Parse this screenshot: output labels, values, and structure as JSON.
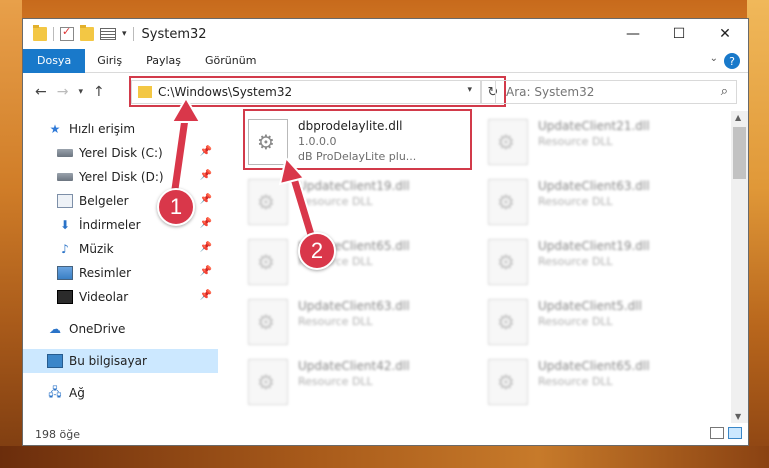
{
  "window": {
    "title": "System32"
  },
  "titlebar": {
    "quick_access_dropdown": "▾",
    "controls": {
      "minimize": "—",
      "maximize": "☐",
      "close": "✕"
    }
  },
  "ribbon": {
    "tabs": [
      {
        "label": "Dosya",
        "active": true
      },
      {
        "label": "Giriş"
      },
      {
        "label": "Paylaş"
      },
      {
        "label": "Görünüm"
      }
    ],
    "collapse_icon": "⌄",
    "help_icon": "?"
  },
  "nav": {
    "back": "←",
    "forward": "→",
    "recent": "▾",
    "up": "↑"
  },
  "address": {
    "path": "C:\\Windows\\System32",
    "dropdown": "▾",
    "refresh": "↻"
  },
  "search": {
    "placeholder": "Ara: System32",
    "icon": "⌕"
  },
  "sidebar": {
    "items": [
      {
        "label": "Hızlı erişim",
        "icon": "star-icon",
        "pinned": false
      },
      {
        "label": "Yerel Disk (C:)",
        "icon": "drive-icon",
        "pinned": true
      },
      {
        "label": "Yerel Disk (D:)",
        "icon": "drive-icon",
        "pinned": true
      },
      {
        "label": "Belgeler",
        "icon": "documents-icon",
        "pinned": true
      },
      {
        "label": "İndirmeler",
        "icon": "download-icon",
        "pinned": true
      },
      {
        "label": "Müzik",
        "icon": "music-icon",
        "pinned": true
      },
      {
        "label": "Resimler",
        "icon": "pictures-icon",
        "pinned": true
      },
      {
        "label": "Videolar",
        "icon": "videos-icon",
        "pinned": true
      },
      {
        "label": "OneDrive",
        "icon": "cloud-icon",
        "pinned": false
      },
      {
        "label": "Bu bilgisayar",
        "icon": "computer-icon",
        "pinned": false,
        "selected": true
      },
      {
        "label": "Ağ",
        "icon": "network-icon",
        "pinned": false
      }
    ],
    "pin_glyph": "📌"
  },
  "files": [
    {
      "name": "dbprodelaylite.dll",
      "version": "1.0.0.0",
      "desc": "dB ProDelayLite plu...",
      "highlighted": true
    },
    {
      "name": "UpdateClient21.dll",
      "desc": "Resource DLL"
    },
    {
      "name": "UpdateClient19.dll",
      "desc": "Resource DLL"
    },
    {
      "name": "UpdateClient63.dll",
      "desc": "Resource DLL"
    },
    {
      "name": "UpdateClient65.dll",
      "desc": "Resource DLL"
    },
    {
      "name": "UpdateClient19.dll",
      "desc": "Resource DLL"
    },
    {
      "name": "UpdateClient63.dll",
      "desc": "Resource DLL"
    },
    {
      "name": "UpdateClient5.dll",
      "desc": "Resource DLL"
    },
    {
      "name": "UpdateClient42.dll",
      "desc": "Resource DLL"
    },
    {
      "name": "UpdateClient65.dll",
      "desc": "Resource DLL"
    }
  ],
  "status": {
    "item_count": "198 öğe"
  },
  "callouts": [
    "1",
    "2"
  ],
  "colors": {
    "accent": "#1979ca",
    "highlight": "#d23a4a",
    "selected": "#cce8ff"
  }
}
